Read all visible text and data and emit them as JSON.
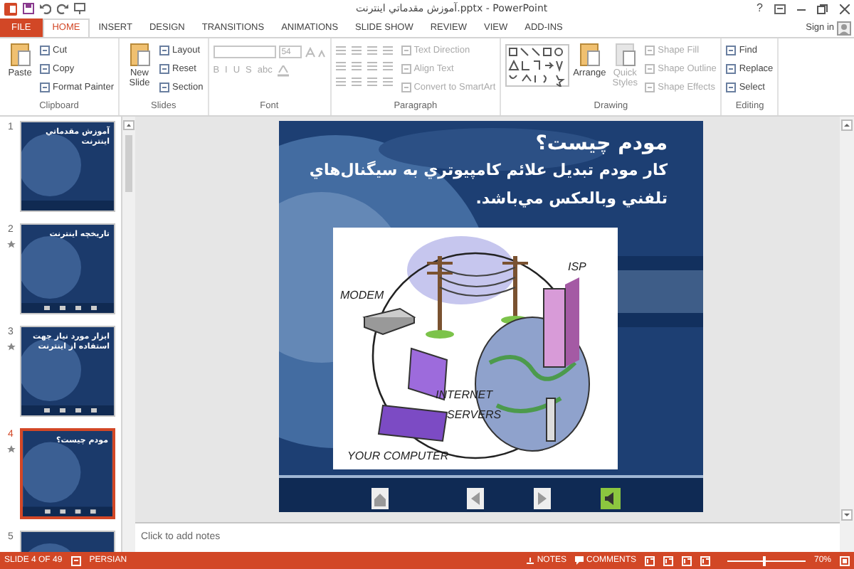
{
  "window": {
    "title": "آموزش مقدماتي اينترنت.pptx - PowerPoint",
    "help": "?",
    "sign_in": "Sign in"
  },
  "tabs": [
    {
      "label": "FILE",
      "kind": "file",
      "selected": false
    },
    {
      "label": "HOME",
      "kind": "tab",
      "selected": true
    },
    {
      "label": "INSERT",
      "kind": "tab",
      "selected": false
    },
    {
      "label": "DESIGN",
      "kind": "tab",
      "selected": false
    },
    {
      "label": "TRANSITIONS",
      "kind": "tab",
      "selected": false
    },
    {
      "label": "ANIMATIONS",
      "kind": "tab",
      "selected": false
    },
    {
      "label": "SLIDE SHOW",
      "kind": "tab",
      "selected": false
    },
    {
      "label": "REVIEW",
      "kind": "tab",
      "selected": false
    },
    {
      "label": "VIEW",
      "kind": "tab",
      "selected": false
    },
    {
      "label": "ADD-INS",
      "kind": "tab",
      "selected": false
    }
  ],
  "ribbon": [
    {
      "label": "Clipboard",
      "kind": "basic",
      "large": [
        {
          "label": "Paste",
          "disabled": false
        }
      ],
      "small": [
        {
          "label": "Cut",
          "disabled": false
        },
        {
          "label": "Copy",
          "disabled": false
        },
        {
          "label": "Format Painter",
          "disabled": false
        }
      ]
    },
    {
      "label": "Slides",
      "kind": "basic",
      "large": [
        {
          "label": "New Slide",
          "disabled": false
        }
      ],
      "small": [
        {
          "label": "Layout",
          "disabled": false
        },
        {
          "label": "Reset",
          "disabled": false
        },
        {
          "label": "Section",
          "disabled": false
        }
      ]
    },
    {
      "label": "Font",
      "kind": "font",
      "font_size": "54",
      "format_buttons": [
        "B",
        "I",
        "U",
        "S",
        "abc"
      ]
    },
    {
      "label": "Paragraph",
      "kind": "paragraph",
      "small": [
        {
          "label": "Text Direction",
          "disabled": true
        },
        {
          "label": "Align Text",
          "disabled": true
        },
        {
          "label": "Convert to SmartArt",
          "disabled": true
        }
      ]
    },
    {
      "label": "Drawing",
      "kind": "drawing",
      "large": [
        {
          "label": "Arrange",
          "disabled": false
        },
        {
          "label": "Quick Styles",
          "disabled": true
        }
      ],
      "small": [
        {
          "label": "Shape Fill",
          "disabled": true
        },
        {
          "label": "Shape Outline",
          "disabled": true
        },
        {
          "label": "Shape Effects",
          "disabled": true
        }
      ]
    },
    {
      "label": "Editing",
      "kind": "basic",
      "small": [
        {
          "label": "Find",
          "disabled": false
        },
        {
          "label": "Replace",
          "disabled": false
        },
        {
          "label": "Select",
          "disabled": false
        }
      ]
    }
  ],
  "thumbnails": [
    {
      "number": "1",
      "animated": false,
      "selected": false,
      "title": "آموزش مقدماتي اينترنت"
    },
    {
      "number": "2",
      "animated": true,
      "selected": false,
      "title": "تاريخچه اينترنت"
    },
    {
      "number": "3",
      "animated": true,
      "selected": false,
      "title": "ابزار مورد نياز جهت استفاده از اينترنت"
    },
    {
      "number": "4",
      "animated": true,
      "selected": true,
      "title": "مودم چيست؟"
    },
    {
      "number": "5",
      "animated": false,
      "selected": false
    }
  ],
  "slide": {
    "title": "مودم چيست؟",
    "body": "كار مودم تبديل علائم كامپيوتري به سيگنال‌هاي تلفني وبالعكس مي‌باشد.",
    "diagram_labels": [
      "MODEM",
      "ISP",
      "INTERNET",
      "SERVERS",
      "YOUR COMPUTER"
    ]
  },
  "notes": {
    "placeholder": "Click to add notes"
  },
  "status_bar": {
    "slide": "SLIDE 4 OF 49",
    "language": "PERSIAN",
    "notes": "NOTES",
    "comments": "COMMENTS",
    "zoom": "70%",
    "zoom_level": {
      "level": 0.45
    }
  }
}
